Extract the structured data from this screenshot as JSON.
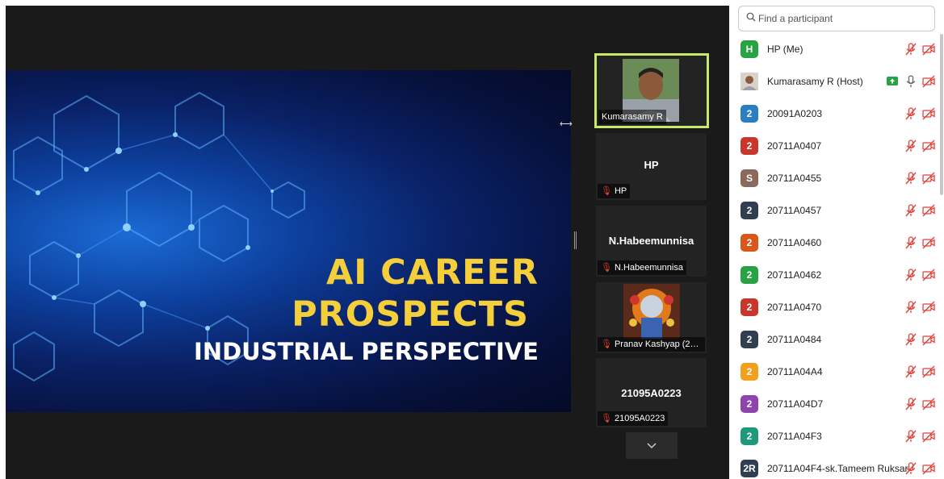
{
  "slide": {
    "title_line1": "AI CAREER",
    "title_line2": "PROSPECTS",
    "subtitle": "INDUSTRIAL PERSPECTIVE"
  },
  "videos": [
    {
      "name": "Kumarasamy R"
    },
    {
      "display": "HP",
      "name": "HP"
    },
    {
      "display": "N.Habeemunnisa",
      "name": "N.Habeemunnisa"
    },
    {
      "name": "Pranav Kashyap (200..."
    },
    {
      "display": "21095A0223",
      "name": "21095A0223"
    }
  ],
  "search": {
    "placeholder": "Find a participant"
  },
  "participants": [
    {
      "initial": "H",
      "color": "#27a343",
      "name": "HP (Me)"
    },
    {
      "initial": "",
      "color": "#7a6a5a",
      "name": "Kumarasamy R (Host)"
    },
    {
      "initial": "2",
      "color": "#2a7fc1",
      "name": "20091A0203"
    },
    {
      "initial": "2",
      "color": "#c8372d",
      "name": "20711A0407"
    },
    {
      "initial": "S",
      "color": "#8a6a5a",
      "name": "20711A0455"
    },
    {
      "initial": "2",
      "color": "#2f3f4f",
      "name": "20711A0457"
    },
    {
      "initial": "2",
      "color": "#d9571b",
      "name": "20711A0460"
    },
    {
      "initial": "2",
      "color": "#27a343",
      "name": "20711A0462"
    },
    {
      "initial": "2",
      "color": "#c8372d",
      "name": "20711A0470"
    },
    {
      "initial": "2",
      "color": "#2f3f4f",
      "name": "20711A0484"
    },
    {
      "initial": "2",
      "color": "#f0a120",
      "name": "20711A04A4"
    },
    {
      "initial": "2",
      "color": "#8e44ad",
      "name": "20711A04D7"
    },
    {
      "initial": "2",
      "color": "#1e9a7a",
      "name": "20711A04F3"
    },
    {
      "initial": "2R",
      "color": "#2f3f4f",
      "name": "20711A04F4-sk.Tameem Ruksar"
    }
  ],
  "colors": {
    "muted_icon": "#e0403a",
    "active_speaker_border": "#c9e86a",
    "share_badge": "#27a343"
  }
}
